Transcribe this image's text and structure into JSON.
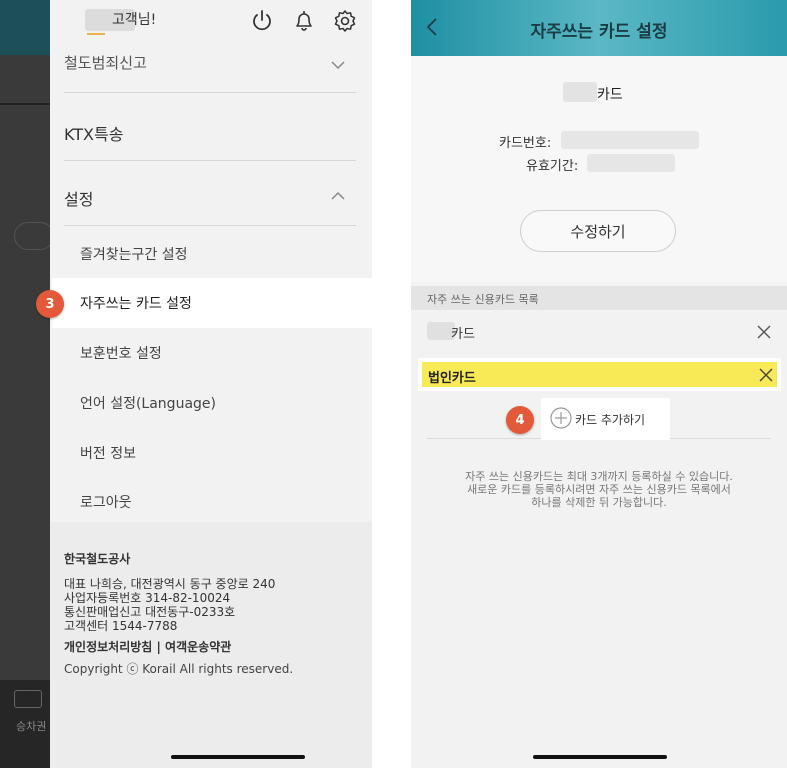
{
  "left_screen": {
    "background": {
      "ticket_label": "승차권"
    },
    "drawer": {
      "greeting": "고객님!",
      "icons": [
        "power-icon",
        "bell-icon",
        "gear-icon"
      ],
      "cut_menu_item": "철도범죄신고",
      "menu": {
        "ktx": "KTX특송",
        "settings": "설정"
      },
      "submenu": [
        "즐겨찾는구간 설정",
        "자주쓰는 카드 설정",
        "보훈번호 설정",
        "언어 설정(Language)",
        "버전 정보",
        "로그아웃"
      ],
      "footer": {
        "company": "한국철도공사",
        "lines": [
          "대표 나희승, 대전광역시 동구 중앙로 240",
          "사업자등록번호 314-82-10024",
          "통신판매업신고 대전동구-0233호",
          "고객센터 1544-7788"
        ],
        "links": "개인정보처리방침 | 여객운송약관",
        "copyright": "Copyright ⓒ Korail All rights reserved."
      }
    },
    "step_badge": "3"
  },
  "right_screen": {
    "title": "자주쓰는 카드 설정",
    "card_name_suffix": "카드",
    "card_number_label": "카드번호:",
    "expiry_label": "유효기간:",
    "edit_button": "수정하기",
    "section_title": "자주 쓰는 신용카드 목록",
    "list": [
      {
        "label": "카드"
      },
      {
        "label": "법인카드"
      }
    ],
    "add_button": "카드 추가하기",
    "step_badge": "4",
    "notice": [
      "자주 쓰는 신용카드는 최대 3개까지 등록하실 수 있습니다.",
      "새로운 카드를 등록하시려면 자주 쓰는 신용카드 목록에서",
      "하나를 삭제한 뒤 가능합니다."
    ]
  },
  "colors": {
    "badge": "#e25a3a",
    "highlight_yellow": "#f8ea57",
    "header_teal": "#2a9aad"
  }
}
